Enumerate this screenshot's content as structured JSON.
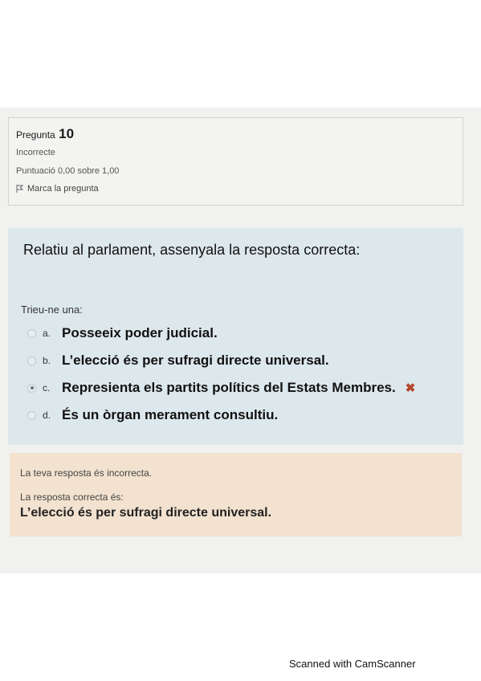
{
  "question": {
    "label": "Pregunta",
    "number": "10",
    "state": "Incorrecte",
    "grade": "Puntuació 0,00 sobre 1,00",
    "flag_label": "Marca la pregunta",
    "text": "Relatiu al parlament, assenyala la resposta correcta:",
    "prompt": "Trieu-ne una:"
  },
  "answers": [
    {
      "letter": "a.",
      "text": "Posseeix poder judicial.",
      "selected": false
    },
    {
      "letter": "b.",
      "text": "L’elecció és per sufragi directe universal.",
      "selected": false
    },
    {
      "letter": "c.",
      "text": "Represienta els partits polítics del Estats Membres.",
      "selected": true,
      "mark": "✖"
    },
    {
      "letter": "d.",
      "text": "És un òrgan merament consultiu.",
      "selected": false
    }
  ],
  "feedback": {
    "incorrect": "La teva resposta és incorrecta.",
    "correct_label": "La resposta correcta és:",
    "correct_answer": "L’elecció és per sufragi directe universal."
  },
  "watermark": "Scanned with CamScanner",
  "colors": {
    "question_bg": "#dde8ec",
    "feedback_bg": "#f2e2cf",
    "incorrect_mark": "#b3472a"
  }
}
